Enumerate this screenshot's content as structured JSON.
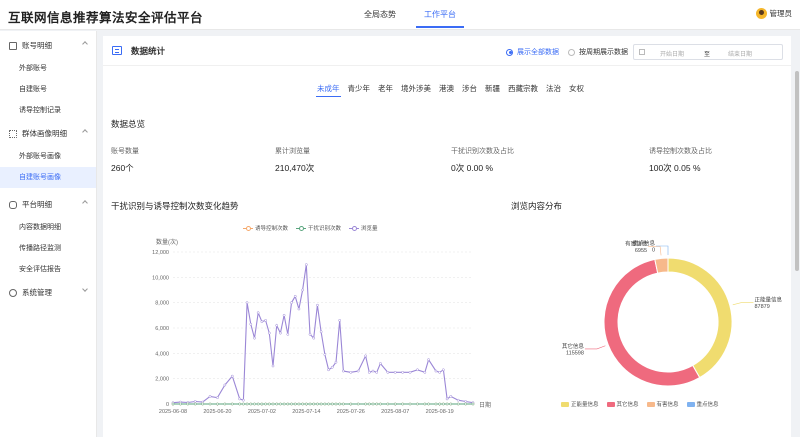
{
  "app": {
    "title": "互联网信息推荐算法安全评估平台"
  },
  "top_nav": {
    "tabs": [
      {
        "label": "全局态势",
        "active": false
      },
      {
        "label": "工作平台",
        "active": true
      }
    ]
  },
  "user": {
    "name": "管理员"
  },
  "sidebar": {
    "groups": [
      {
        "label": "账号明细",
        "icon": "user-list-icon",
        "expanded": true,
        "items": [
          {
            "label": "外部账号"
          },
          {
            "label": "自建账号"
          },
          {
            "label": "诱导控制记录"
          }
        ]
      },
      {
        "label": "群体画像明细",
        "icon": "grid-icon",
        "expanded": true,
        "items": [
          {
            "label": "外部账号画像"
          },
          {
            "label": "自建账号画像",
            "active": true
          }
        ]
      },
      {
        "label": "平台明细",
        "icon": "platform-icon",
        "expanded": true,
        "items": [
          {
            "label": "内容数据明细"
          },
          {
            "label": "传播路径监测"
          },
          {
            "label": "安全评估报告"
          }
        ]
      },
      {
        "label": "系统管理",
        "icon": "person-icon",
        "expanded": false,
        "items": []
      }
    ]
  },
  "panel": {
    "title": "数据统计",
    "radio_all": "展示全部数据",
    "radio_period": "按周期展示数据",
    "date_start_placeholder": "开始日期",
    "date_sep": "至",
    "date_end_placeholder": "结束日期"
  },
  "category_tabs": [
    "未成年",
    "青少年",
    "老年",
    "境外涉美",
    "港澳",
    "涉台",
    "新疆",
    "西藏宗教",
    "法治",
    "女权"
  ],
  "overview": {
    "title": "数据总览",
    "stats": [
      {
        "label": "账号数量",
        "value": "260个"
      },
      {
        "label": "累计浏览量",
        "value": "210,470次"
      },
      {
        "label": "干扰识别次数及占比",
        "value": "0次 0.00 %"
      },
      {
        "label": "诱导控制次数及占比",
        "value": "100次 0.05 %"
      }
    ]
  },
  "trend": {
    "title": "干扰识别与诱导控制次数变化趋势",
    "legend": [
      "诱导控制次数",
      "干扰识别次数",
      "浏览量"
    ],
    "ylabel": "数量(次)",
    "xlabel": "日期"
  },
  "distribution": {
    "title": "浏览内容分布",
    "legend": [
      "正能量信息",
      "其它信息",
      "有害信息",
      "重点信息"
    ]
  },
  "colors": {
    "accent": "#3b6cf5",
    "line_induce": "#f5a86b",
    "line_interfere": "#5aa57e",
    "line_views": "#9b87d6",
    "pie_positive": "#f0dc6f",
    "pie_other": "#ef6a7e",
    "pie_harmful": "#f7b98b",
    "pie_key": "#7fb2f0"
  },
  "chart_data": [
    {
      "type": "line",
      "title": "干扰识别与诱导控制次数变化趋势",
      "xlabel": "日期",
      "ylabel": "数量(次)",
      "ylim": [
        0,
        12000
      ],
      "yticks": [
        0,
        2000,
        4000,
        6000,
        8000,
        10000,
        12000
      ],
      "xtick_labels": [
        "2025-06-08",
        "2025-06-20",
        "2025-07-02",
        "2025-07-14",
        "2025-07-26",
        "2025-08-07",
        "2025-08-19"
      ],
      "legend_position": "top",
      "grid": true,
      "x": [
        "2025-06-08",
        "2025-06-10",
        "2025-06-12",
        "2025-06-14",
        "2025-06-16",
        "2025-06-18",
        "2025-06-20",
        "2025-06-22",
        "2025-06-24",
        "2025-06-26",
        "2025-06-27",
        "2025-06-28",
        "2025-06-29",
        "2025-06-30",
        "2025-07-01",
        "2025-07-02",
        "2025-07-03",
        "2025-07-04",
        "2025-07-05",
        "2025-07-06",
        "2025-07-07",
        "2025-07-08",
        "2025-07-09",
        "2025-07-10",
        "2025-07-11",
        "2025-07-12",
        "2025-07-13",
        "2025-07-14",
        "2025-07-15",
        "2025-07-16",
        "2025-07-17",
        "2025-07-18",
        "2025-07-19",
        "2025-07-20",
        "2025-07-21",
        "2025-07-22",
        "2025-07-23",
        "2025-07-24",
        "2025-07-26",
        "2025-07-28",
        "2025-07-30",
        "2025-07-31",
        "2025-08-01",
        "2025-08-02",
        "2025-08-03",
        "2025-08-05",
        "2025-08-07",
        "2025-08-09",
        "2025-08-11",
        "2025-08-13",
        "2025-08-15",
        "2025-08-16",
        "2025-08-18",
        "2025-08-19",
        "2025-08-20",
        "2025-08-21",
        "2025-08-22",
        "2025-08-24",
        "2025-08-26",
        "2025-08-28"
      ],
      "series": [
        {
          "name": "诱导控制次数",
          "values": [
            0,
            0,
            0,
            0,
            0,
            0,
            0,
            0,
            0,
            0,
            0,
            0,
            0,
            0,
            0,
            0,
            0,
            0,
            0,
            0,
            0,
            0,
            0,
            0,
            0,
            0,
            0,
            0,
            0,
            0,
            0,
            0,
            0,
            0,
            0,
            0,
            0,
            0,
            0,
            0,
            0,
            0,
            0,
            0,
            0,
            0,
            0,
            0,
            0,
            0,
            0,
            0,
            0,
            0,
            0,
            0,
            0,
            0,
            0,
            0
          ]
        },
        {
          "name": "干扰识别次数",
          "values": [
            0,
            0,
            0,
            0,
            0,
            0,
            0,
            0,
            0,
            0,
            0,
            0,
            0,
            0,
            0,
            0,
            0,
            0,
            0,
            0,
            0,
            0,
            0,
            0,
            0,
            0,
            0,
            0,
            0,
            0,
            0,
            0,
            0,
            0,
            0,
            0,
            0,
            0,
            0,
            0,
            0,
            0,
            0,
            0,
            0,
            0,
            0,
            0,
            0,
            0,
            0,
            0,
            0,
            0,
            0,
            0,
            0,
            0,
            0,
            0
          ]
        },
        {
          "name": "浏览量",
          "values": [
            100,
            150,
            120,
            200,
            150,
            600,
            500,
            1500,
            2200,
            400,
            300,
            8000,
            6300,
            5200,
            7200,
            6500,
            6600,
            5600,
            3000,
            6200,
            5600,
            7000,
            5500,
            8000,
            8500,
            7500,
            9000,
            11000,
            5500,
            5200,
            7800,
            5700,
            3900,
            2700,
            2900,
            3300,
            6600,
            2600,
            2500,
            2600,
            3800,
            2500,
            2600,
            2500,
            3200,
            2500,
            2500,
            2500,
            2500,
            2700,
            2500,
            3500,
            2600,
            2500,
            2700,
            400,
            600,
            300,
            200,
            100
          ]
        }
      ]
    },
    {
      "type": "pie",
      "title": "浏览内容分布",
      "legend_position": "bottom",
      "labels": [
        "正能量信息",
        "其它信息",
        "有害信息",
        "重点信息"
      ],
      "values": [
        87879,
        115598,
        6955,
        0
      ]
    }
  ]
}
